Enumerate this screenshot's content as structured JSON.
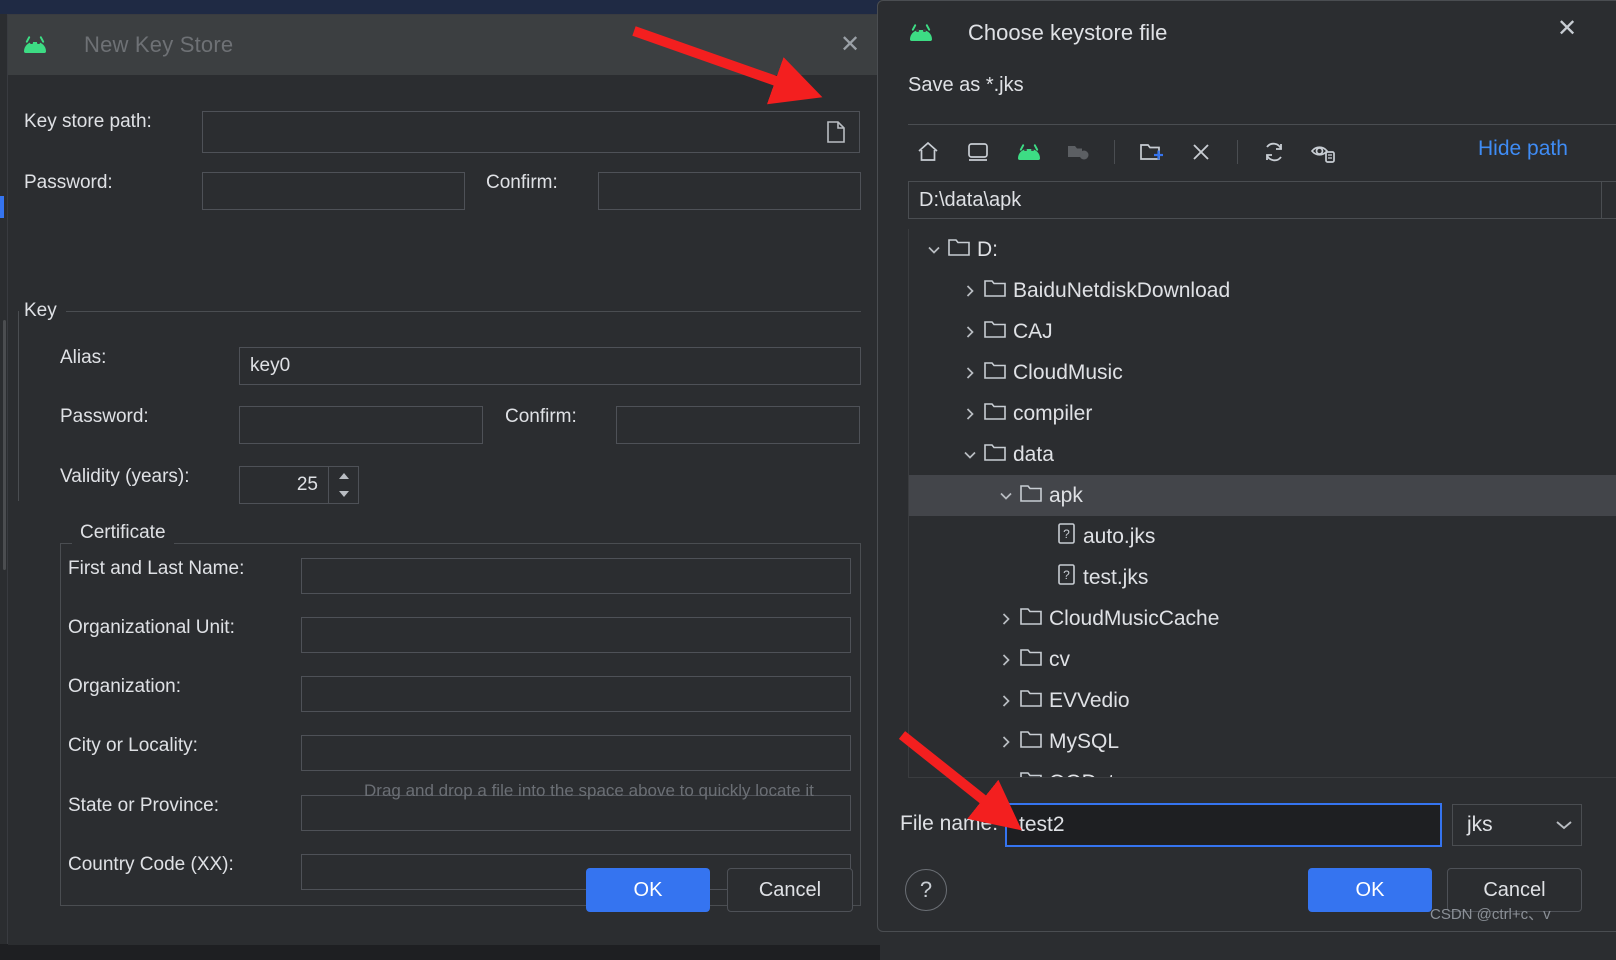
{
  "new_key_store": {
    "title": "New Key Store",
    "app_icon": "android-robot-icon",
    "close_label": "✕",
    "key_store_path_label": "Key store path:",
    "key_store_path_value": "",
    "browse_icon": "folder-icon",
    "password_label": "Password:",
    "password_value": "",
    "confirm_label": "Confirm:",
    "confirm_value": "",
    "key_group_label": "Key",
    "alias_label": "Alias:",
    "alias_value": "key0",
    "key_password_label": "Password:",
    "key_password_value": "",
    "key_confirm_label": "Confirm:",
    "key_confirm_value": "",
    "validity_label": "Validity (years):",
    "validity_value": "25",
    "certificate_group_label": "Certificate",
    "certificate_fields": [
      {
        "label": "First and Last Name:",
        "value": ""
      },
      {
        "label": "Organizational Unit:",
        "value": ""
      },
      {
        "label": "Organization:",
        "value": ""
      },
      {
        "label": "City or Locality:",
        "value": ""
      },
      {
        "label": "State or Province:",
        "value": ""
      },
      {
        "label": "Country Code (XX):",
        "value": ""
      }
    ],
    "ok_label": "OK",
    "cancel_label": "Cancel"
  },
  "choose_keystore": {
    "title": "Choose keystore file",
    "app_icon": "android-robot-icon",
    "close_label": "✕",
    "save_as_label": "Save as *.jks",
    "toolbar": [
      {
        "name": "home-icon",
        "title": "Home"
      },
      {
        "name": "desktop-icon",
        "title": "Desktop"
      },
      {
        "name": "android-robot-icon",
        "title": "Android SDK"
      },
      {
        "name": "project-folder-icon",
        "title": "Project"
      },
      {
        "name": "new-folder-icon",
        "title": "New Folder"
      },
      {
        "name": "delete-x-icon",
        "title": "Delete"
      },
      {
        "name": "refresh-icon",
        "title": "Refresh"
      },
      {
        "name": "show-hidden-files-icon",
        "title": "Show Hidden Files"
      }
    ],
    "hide_path_label": "Hide path",
    "path_value": "D:\\data\\apk",
    "path_dropdown_icon": "chevron-down-icon",
    "tree": [
      {
        "name": "D:",
        "type": "folder",
        "depth": 0,
        "state": "expanded",
        "selected": false
      },
      {
        "name": "BaiduNetdiskDownload",
        "type": "folder",
        "depth": 1,
        "state": "collapsed",
        "selected": false
      },
      {
        "name": "CAJ",
        "type": "folder",
        "depth": 1,
        "state": "collapsed",
        "selected": false
      },
      {
        "name": "CloudMusic",
        "type": "folder",
        "depth": 1,
        "state": "collapsed",
        "selected": false
      },
      {
        "name": "compiler",
        "type": "folder",
        "depth": 1,
        "state": "collapsed",
        "selected": false
      },
      {
        "name": "data",
        "type": "folder",
        "depth": 1,
        "state": "expanded",
        "selected": false
      },
      {
        "name": "apk",
        "type": "folder",
        "depth": 2,
        "state": "expanded",
        "selected": true
      },
      {
        "name": "auto.jks",
        "type": "file",
        "depth": 3,
        "state": "leaf",
        "selected": false
      },
      {
        "name": "test.jks",
        "type": "file",
        "depth": 3,
        "state": "leaf",
        "selected": false
      },
      {
        "name": "CloudMusicCache",
        "type": "folder",
        "depth": 2,
        "state": "collapsed",
        "selected": false
      },
      {
        "name": "cv",
        "type": "folder",
        "depth": 2,
        "state": "collapsed",
        "selected": false
      },
      {
        "name": "EVVedio",
        "type": "folder",
        "depth": 2,
        "state": "collapsed",
        "selected": false
      },
      {
        "name": "MySQL",
        "type": "folder",
        "depth": 2,
        "state": "collapsed",
        "selected": false
      },
      {
        "name": "QQData",
        "type": "folder",
        "depth": 2,
        "state": "collapsed",
        "selected": false
      }
    ],
    "drag_hint": "Drag and drop a file into the space above to quickly locate it",
    "file_name_label": "File name:",
    "file_name_value": "test2",
    "extension_value": "jks",
    "extension_chevron_icon": "chevron-down-icon",
    "help_label": "?",
    "ok_label": "OK",
    "cancel_label": "Cancel"
  },
  "watermark": "CSDN @ctrl+c、v",
  "colors": {
    "accent_blue": "#3574F0",
    "link_blue": "#3F8CF5",
    "android_green": "#3DDC84",
    "arrow_red": "#F31F1F",
    "dialog_bg": "#2B2D30",
    "title_bg": "#3C3F41",
    "selected_row": "#43454A"
  }
}
